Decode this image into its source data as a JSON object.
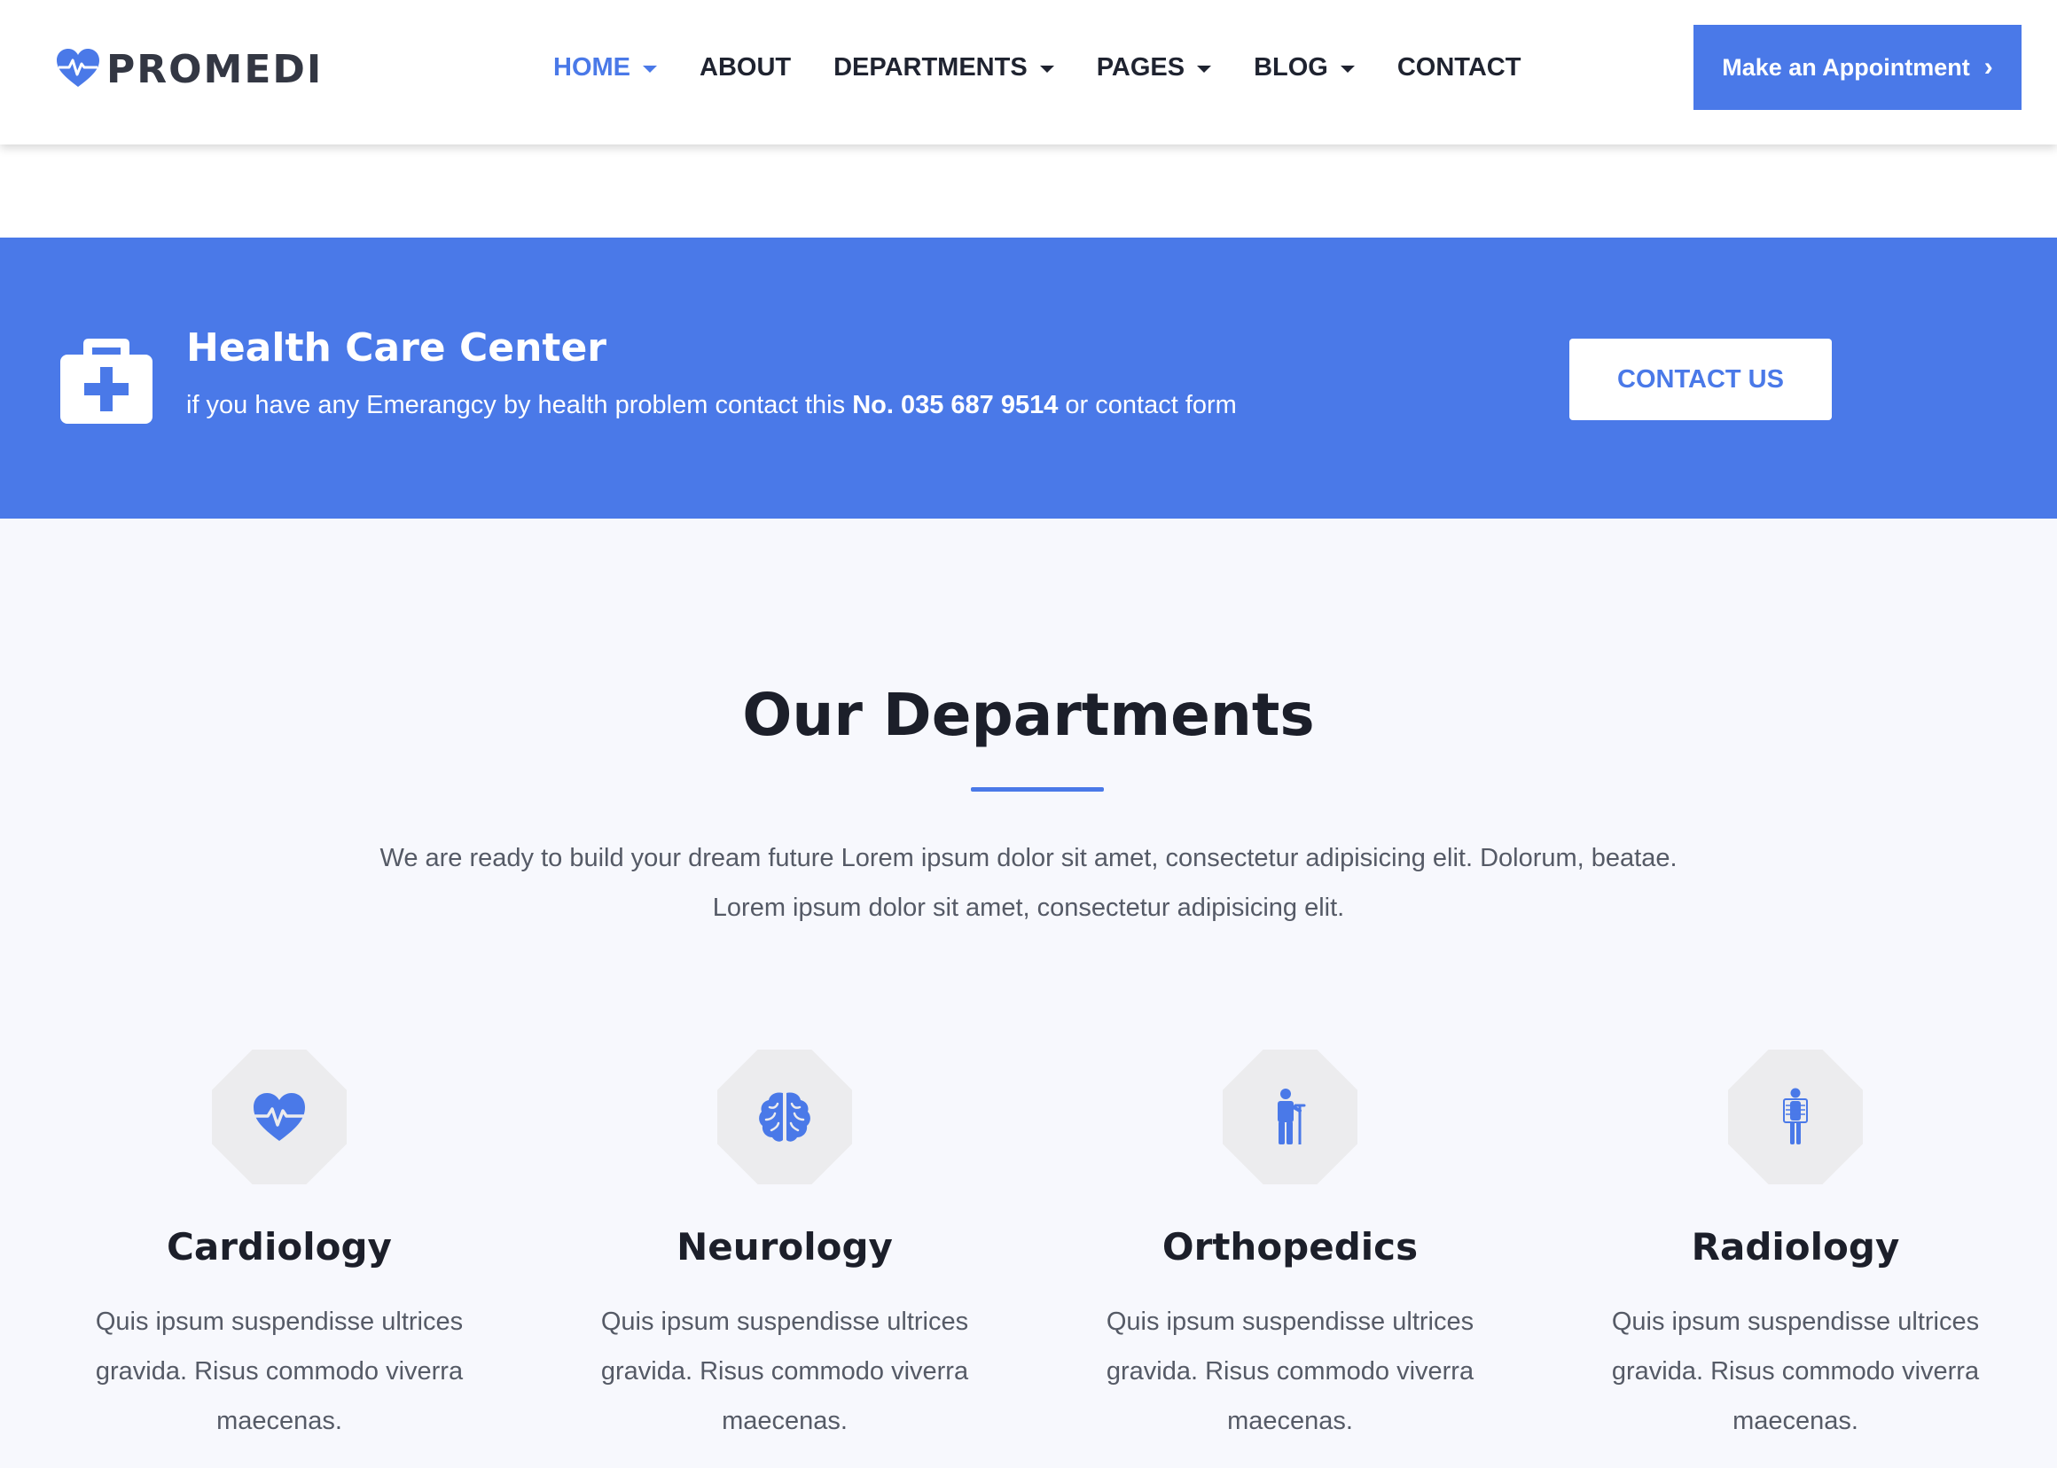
{
  "header": {
    "logo_text": "PROMEDI",
    "nav": [
      {
        "label": "HOME",
        "has_dropdown": true,
        "active": true
      },
      {
        "label": "ABOUT",
        "has_dropdown": false,
        "active": false
      },
      {
        "label": "DEPARTMENTS",
        "has_dropdown": true,
        "active": false
      },
      {
        "label": "PAGES",
        "has_dropdown": true,
        "active": false
      },
      {
        "label": "BLOG",
        "has_dropdown": true,
        "active": false
      },
      {
        "label": "CONTACT",
        "has_dropdown": false,
        "active": false
      }
    ],
    "appointment_button": "Make an Appointment",
    "appointment_chevron": "›"
  },
  "banner": {
    "icon": "first-aid-kit-icon",
    "title": "Health Care Center",
    "text_before": "if you have any Emerangcy by health problem contact this ",
    "phone": "No. 035 687 9514",
    "text_after": " or contact form",
    "button": "CONTACT US"
  },
  "departments": {
    "title": "Our Departments",
    "description": "We are ready to build your dream future Lorem ipsum dolor sit amet, consectetur adipisicing elit. Dolorum, beatae. Lorem ipsum dolor sit amet, consectetur adipisicing elit.",
    "items": [
      {
        "name": "Cardiology",
        "icon": "heart-pulse-icon",
        "text": "Quis ipsum suspendisse ultrices gravida. Risus commodo viverra maecenas."
      },
      {
        "name": "Neurology",
        "icon": "brain-icon",
        "text": "Quis ipsum suspendisse ultrices gravida. Risus commodo viverra maecenas."
      },
      {
        "name": "Orthopedics",
        "icon": "person-crutch-icon",
        "text": "Quis ipsum suspendisse ultrices gravida. Risus commodo viverra maecenas."
      },
      {
        "name": "Radiology",
        "icon": "xray-person-icon",
        "text": "Quis ipsum suspendisse ultrices gravida. Risus commodo viverra maecenas."
      }
    ]
  },
  "colors": {
    "accent": "#4a79e8",
    "heading": "#1c1f2a",
    "body_text": "#555a66",
    "section_bg": "#f7f8fd",
    "icon_bg": "#ececee"
  }
}
